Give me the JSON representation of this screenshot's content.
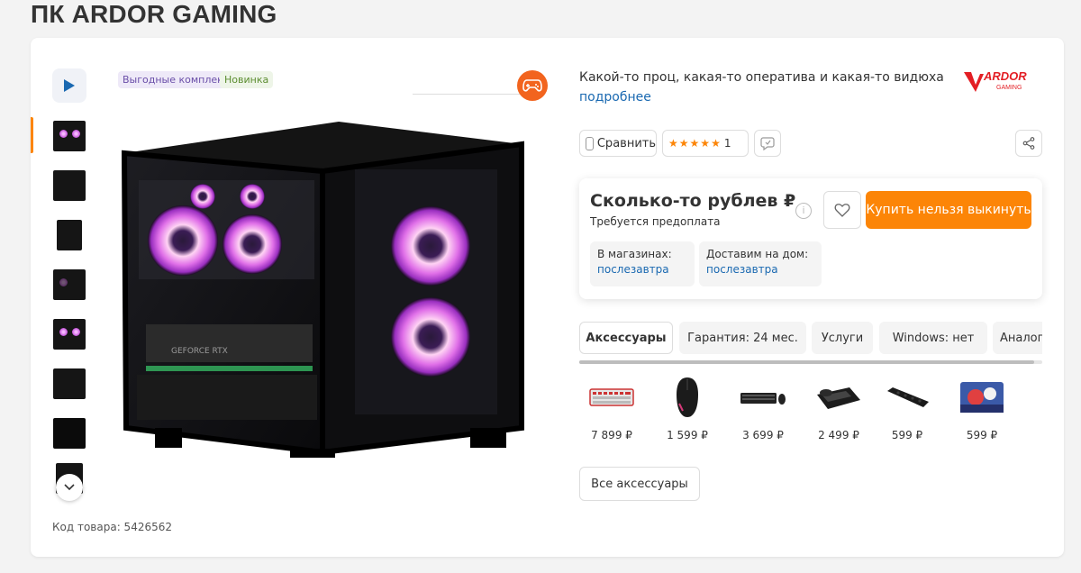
{
  "page": {
    "title": "ПК ARDOR GAMING"
  },
  "gallery": {
    "badges": {
      "promo": "Выгодные комплекты",
      "new": "Новинка"
    },
    "sku_label": "Код товара: 5426562"
  },
  "info": {
    "description": "Какой-то проц, какая-то оператива и какая-то видюха",
    "more_link": "подробнее",
    "brand": {
      "name": "ARDOR",
      "sub": "GAMING"
    },
    "compare_label": "Сравнить",
    "rating_count": "1",
    "rating_stars": 5
  },
  "buy": {
    "price": "Сколько-то рублев ₽",
    "prepay_note": "Требуется предоплата",
    "buy_button": "Купить нельзя выкинуть",
    "availability": [
      {
        "label": "В магазинах:",
        "value": "послезавтра"
      },
      {
        "label": "Доставим на дом:",
        "value": "послезавтра"
      }
    ]
  },
  "tabs": [
    {
      "label": "Аксессуары"
    },
    {
      "label": "Гарантия: 24 мес."
    },
    {
      "label": "Услуги"
    },
    {
      "label": "Windows: нет"
    },
    {
      "label": "Аналоги"
    }
  ],
  "accessories": [
    {
      "name": "keyboard-icon",
      "price": "7 899 ₽"
    },
    {
      "name": "mouse-icon",
      "price": "1 599 ₽"
    },
    {
      "name": "keyboard-mouse-set-icon",
      "price": "3 699 ₽"
    },
    {
      "name": "gamepad-keyboard-icon",
      "price": "2 499 ₽"
    },
    {
      "name": "power-strip-icon",
      "price": "599 ₽"
    },
    {
      "name": "mousepad-icon",
      "price": "599 ₽"
    }
  ],
  "all_accessories_label": "Все аксессуары",
  "colors": {
    "accent": "#fc8507",
    "link": "#1a69b1",
    "gamepad_badge": "#f2641e"
  }
}
